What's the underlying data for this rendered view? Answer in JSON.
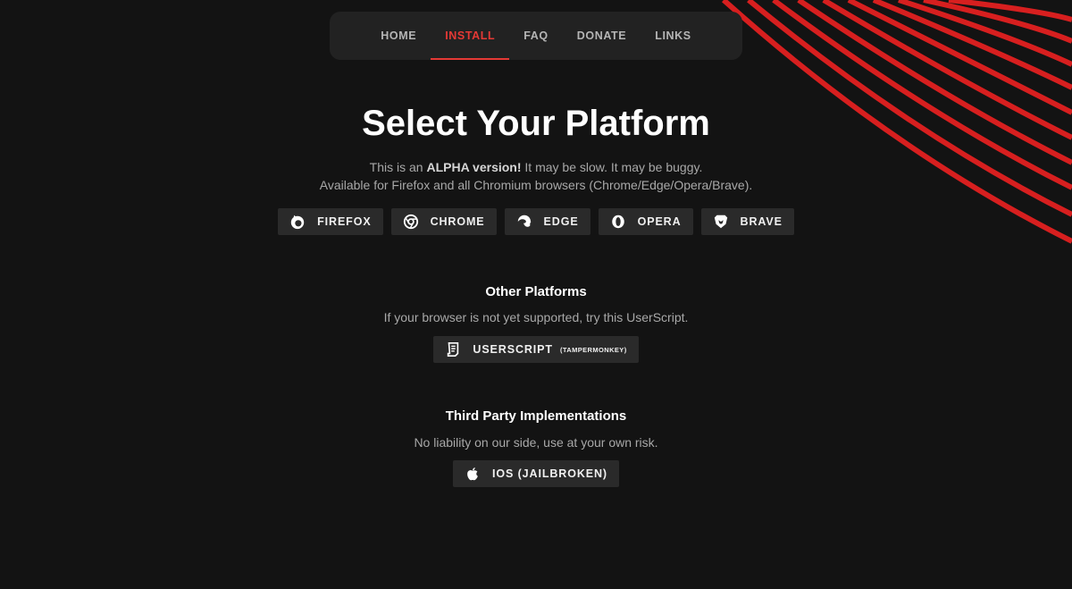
{
  "nav": {
    "items": [
      {
        "label": "HOME",
        "active": false
      },
      {
        "label": "INSTALL",
        "active": true
      },
      {
        "label": "FAQ",
        "active": false
      },
      {
        "label": "DONATE",
        "active": false
      },
      {
        "label": "LINKS",
        "active": false
      }
    ]
  },
  "header": {
    "title": "Select Your Platform",
    "line1_prefix": "This is an ",
    "line1_bold": "ALPHA version!",
    "line1_suffix": " It may be slow. It may be buggy.",
    "line2": "Available for Firefox and all Chromium browsers (Chrome/Edge/Opera/Brave)."
  },
  "browsers": [
    {
      "label": "FIREFOX",
      "icon": "firefox-icon"
    },
    {
      "label": "CHROME",
      "icon": "chrome-icon"
    },
    {
      "label": "EDGE",
      "icon": "edge-icon"
    },
    {
      "label": "OPERA",
      "icon": "opera-icon"
    },
    {
      "label": "BRAVE",
      "icon": "brave-icon"
    }
  ],
  "other": {
    "heading": "Other Platforms",
    "text": "If your browser is not yet supported, try this UserScript.",
    "button_label": "USERSCRIPT",
    "button_note": "(TAMPERMONKEY)",
    "icon": "script-icon"
  },
  "third_party": {
    "heading": "Third Party Implementations",
    "text": "No liability on our side, use at your own risk.",
    "button_label": "IOS (JAILBROKEN)",
    "icon": "apple-icon"
  },
  "colors": {
    "accent": "#e53935",
    "background": "#131313",
    "nav_bg": "#222222",
    "button_bg": "#2a2a2a"
  }
}
